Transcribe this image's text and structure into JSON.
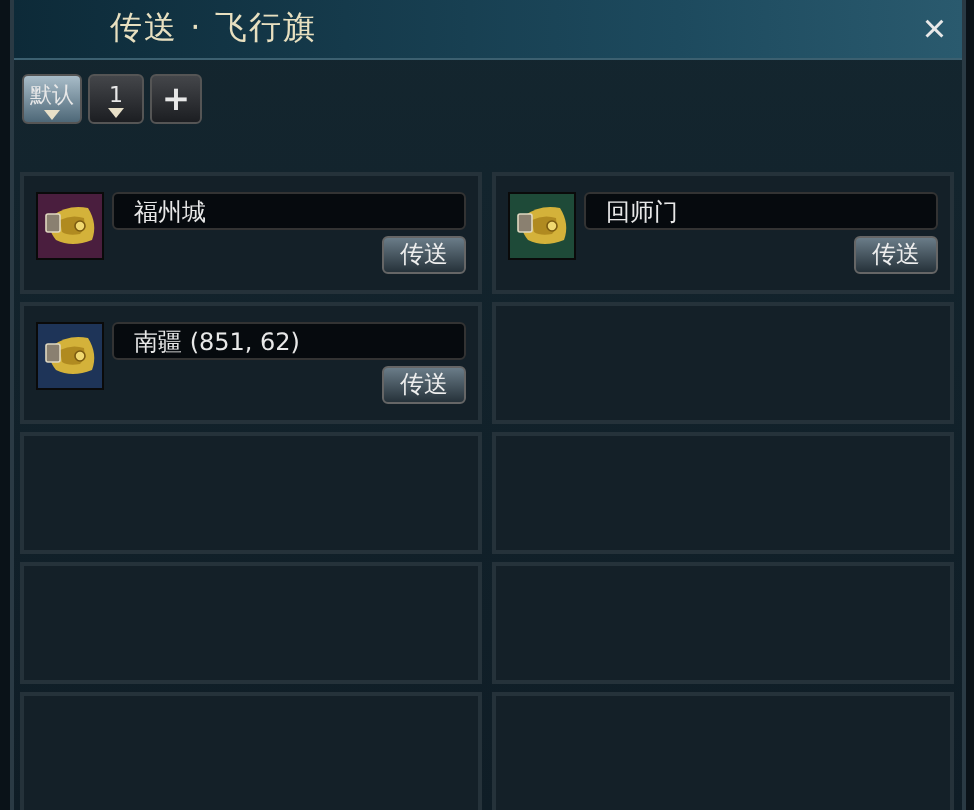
{
  "window": {
    "title": "传送 · 飞行旗",
    "close": "×"
  },
  "tabs": [
    {
      "label": "默认",
      "selected": true
    },
    {
      "label": "1",
      "selected": false
    }
  ],
  "add_button": "+",
  "slots": [
    {
      "kind": "flag",
      "name": "福州城",
      "button": "传送",
      "color": "#4a1e3e"
    },
    {
      "kind": "flag",
      "name": "回师门",
      "button": "传送",
      "color": "#1e4a38"
    },
    {
      "kind": "flag",
      "name": "南疆 (851, 62)",
      "button": "传送",
      "color": "#1e3458"
    },
    {
      "kind": "empty"
    },
    {
      "kind": "empty"
    },
    {
      "kind": "empty"
    },
    {
      "kind": "empty"
    },
    {
      "kind": "empty"
    },
    {
      "kind": "empty"
    },
    {
      "kind": "empty"
    }
  ]
}
